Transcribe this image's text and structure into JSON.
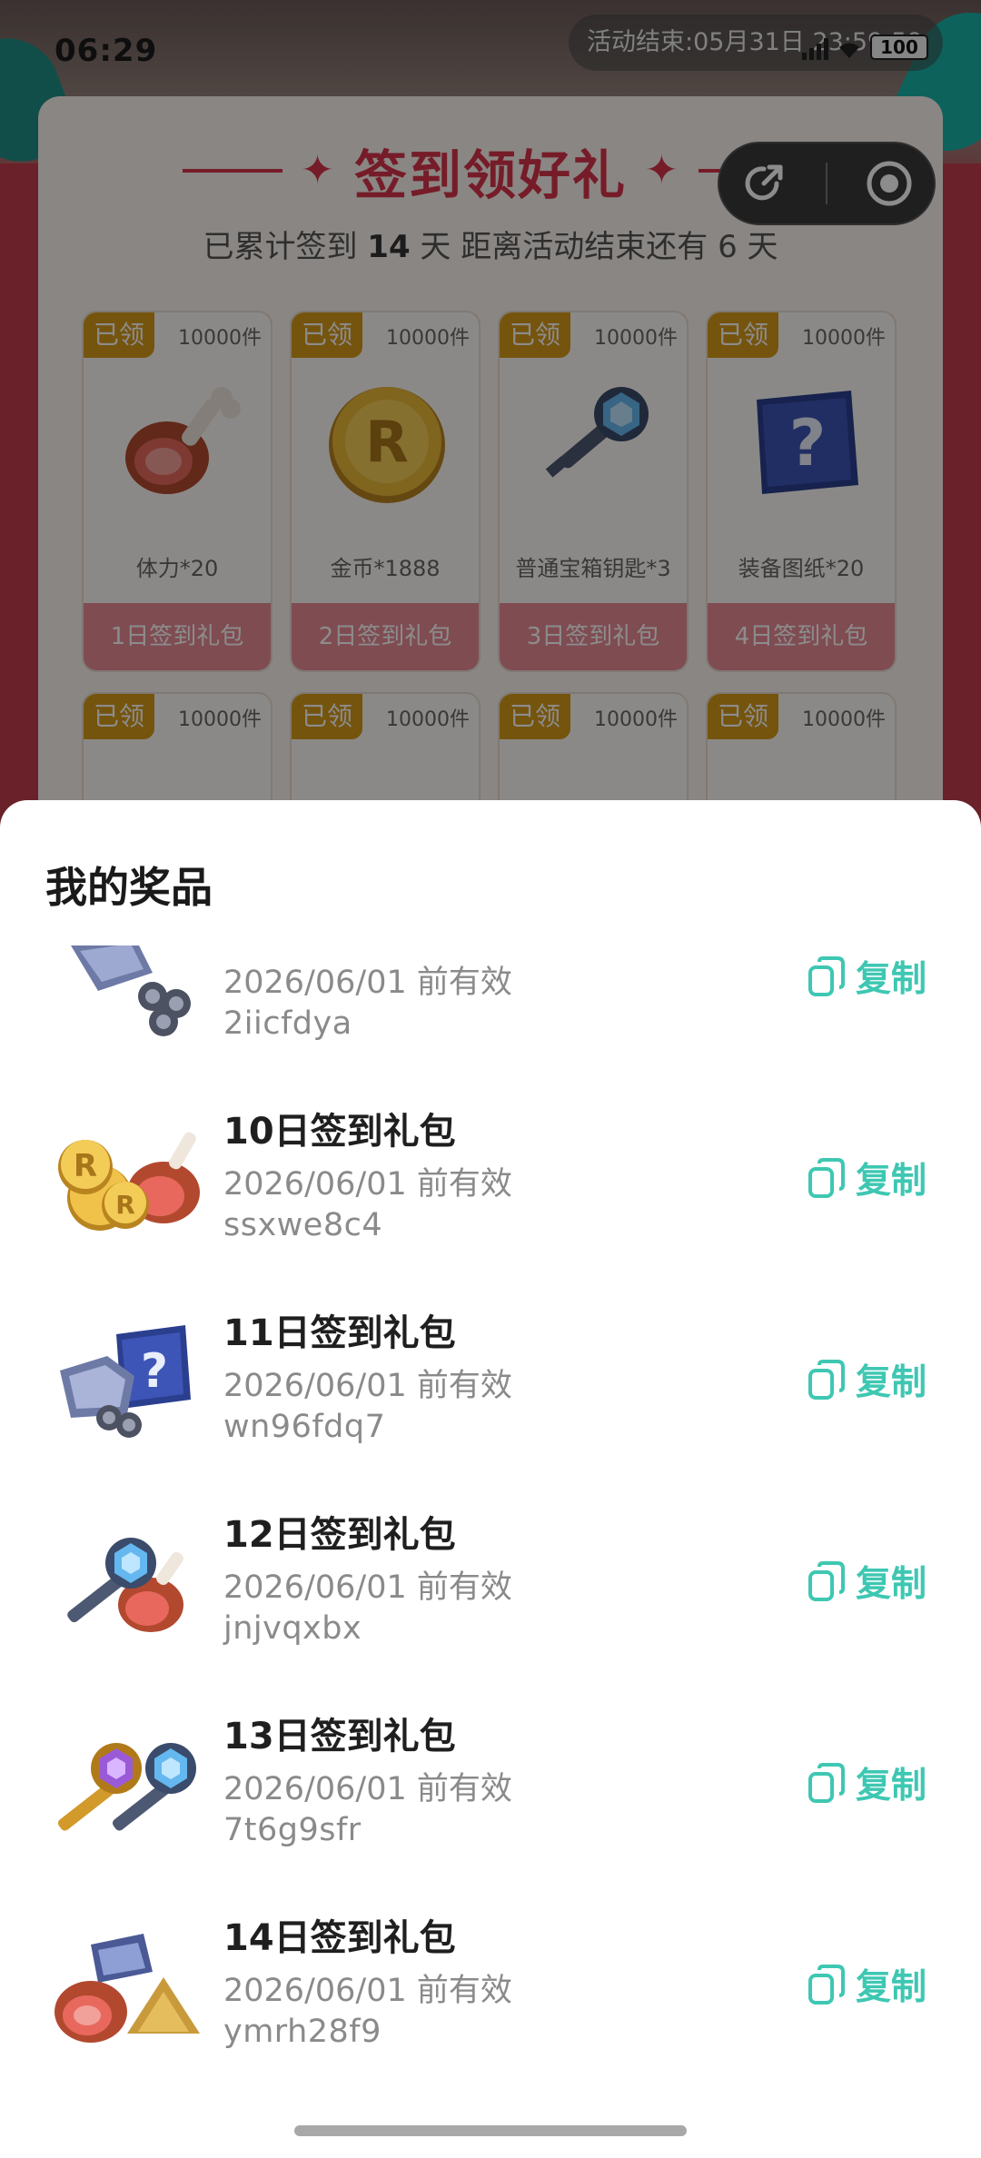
{
  "status_bar": {
    "time": "06:29",
    "event_end_text": "活动结束:05月31日 23:59:59",
    "battery": "100"
  },
  "card": {
    "title": "签到领好礼",
    "subtitle_pre": "已累计签到 ",
    "days_checked": "14",
    "subtitle_mid": " 天  距离活动结束还有 ",
    "days_left": "6",
    "subtitle_post": " 天"
  },
  "mini_program_controls": {
    "share_icon": "share-icon",
    "close_icon": "record-close-icon"
  },
  "reward_tiles": [
    {
      "claimed": "已领",
      "count": "10000件",
      "name": "体力*20",
      "footer": "1日签到礼包",
      "art": "meat"
    },
    {
      "claimed": "已领",
      "count": "10000件",
      "name": "金币*1888",
      "footer": "2日签到礼包",
      "art": "coin"
    },
    {
      "claimed": "已领",
      "count": "10000件",
      "name": "普通宝箱钥匙*3",
      "footer": "3日签到礼包",
      "art": "key"
    },
    {
      "claimed": "已领",
      "count": "10000件",
      "name": "装备图纸*20",
      "footer": "4日签到礼包",
      "art": "blueprint"
    },
    {
      "claimed": "已领",
      "count": "10000件"
    },
    {
      "claimed": "已领",
      "count": "10000件"
    },
    {
      "claimed": "已领",
      "count": "10000件"
    },
    {
      "claimed": "已领",
      "count": "10000件"
    }
  ],
  "sheet": {
    "title": "我的奖品",
    "copy_label": "复制",
    "items": [
      {
        "title": "",
        "valid": "2026/06/01 前有效",
        "code": "2iicfdya",
        "icon": "ore-bundle"
      },
      {
        "title": "10日签到礼包",
        "valid": "2026/06/01 前有效",
        "code": "ssxwe8c4",
        "icon": "coin-meat"
      },
      {
        "title": "11日签到礼包",
        "valid": "2026/06/01 前有效",
        "code": "wn96fdq7",
        "icon": "ore-blueprint"
      },
      {
        "title": "12日签到礼包",
        "valid": "2026/06/01 前有效",
        "code": "jnjvqxbx",
        "icon": "key-meat"
      },
      {
        "title": "13日签到礼包",
        "valid": "2026/06/01 前有效",
        "code": "7t6g9sfr",
        "icon": "two-keys"
      },
      {
        "title": "14日签到礼包",
        "valid": "2026/06/01 前有效",
        "code": "ymrh28f9",
        "icon": "meat-ore-sand"
      }
    ]
  },
  "colors": {
    "accent_red": "#d7334c",
    "claimed_gold": "#d59a1a",
    "copy_teal": "#3ec7b2"
  }
}
